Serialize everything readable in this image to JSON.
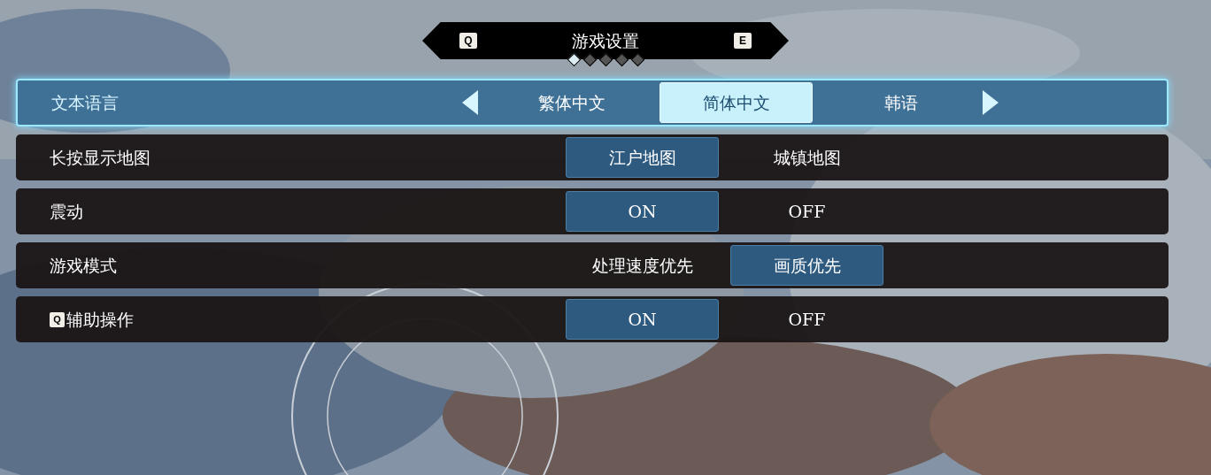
{
  "header": {
    "title": "游戏设置",
    "prev_key": "Q",
    "next_key": "E",
    "pages": [
      {
        "selected": true
      },
      {
        "selected": false
      },
      {
        "selected": false
      },
      {
        "selected": false
      },
      {
        "selected": false
      }
    ]
  },
  "settings": [
    {
      "label": "文本语言",
      "focused": true,
      "kind": "carousel",
      "options": [
        {
          "label": "繁体中文",
          "selected": false
        },
        {
          "label": "简体中文",
          "selected": true
        },
        {
          "label": "韩语",
          "selected": false
        }
      ]
    },
    {
      "label": "长按显示地图",
      "focused": false,
      "kind": "toggle",
      "options": [
        {
          "label": "江户地图",
          "selected": true
        },
        {
          "label": "城镇地图",
          "selected": false
        }
      ]
    },
    {
      "label": "震动",
      "focused": false,
      "kind": "toggle",
      "options": [
        {
          "label": "ON",
          "selected": true
        },
        {
          "label": "OFF",
          "selected": false
        }
      ]
    },
    {
      "label": "游戏模式",
      "focused": false,
      "kind": "toggle",
      "options": [
        {
          "label": "处理速度优先",
          "selected": false
        },
        {
          "label": "画质优先",
          "selected": true
        }
      ]
    },
    {
      "label": "辅助操作",
      "key": "Q",
      "focused": false,
      "kind": "toggle",
      "options": [
        {
          "label": "ON",
          "selected": true
        },
        {
          "label": "OFF",
          "selected": false
        }
      ]
    }
  ]
}
